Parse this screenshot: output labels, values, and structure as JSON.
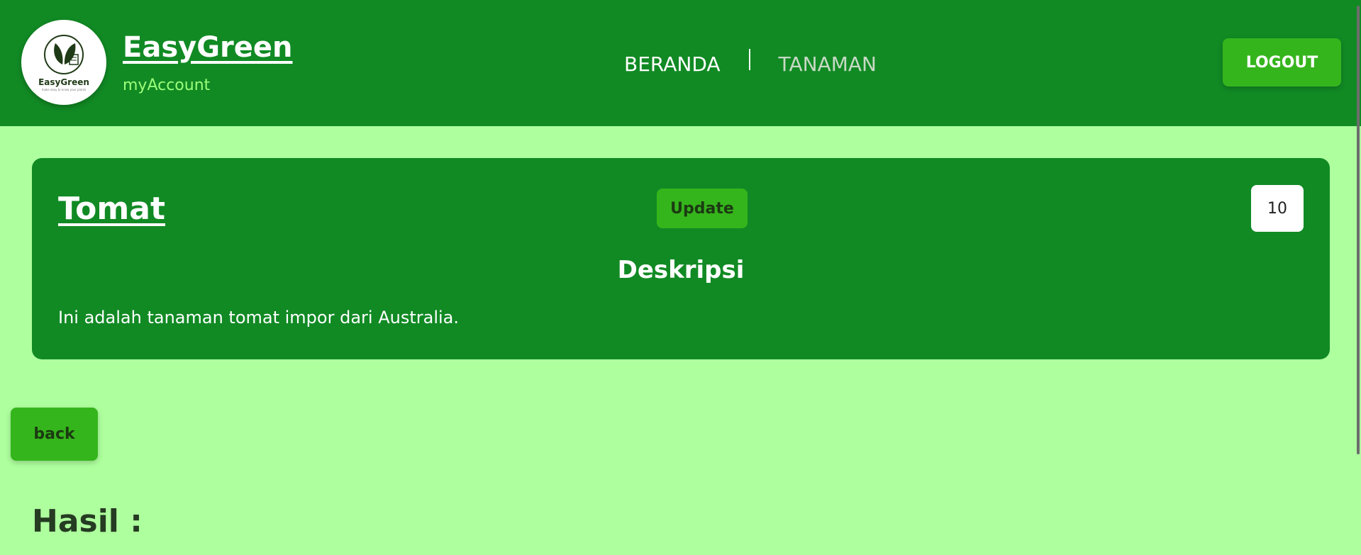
{
  "header": {
    "logo_text": "EasyGreen",
    "logo_tagline": "make easy to know your plants",
    "brand": "EasyGreen",
    "sub_brand": "myAccount",
    "nav": [
      {
        "label": "BERANDA"
      },
      {
        "label": "TANAMAN"
      }
    ],
    "logout_label": "LOGOUT"
  },
  "plant": {
    "name": "Tomat",
    "update_label": "Update",
    "quantity": "10",
    "description_heading": "Deskripsi",
    "description": "Ini adalah tanaman tomat impor dari Australia."
  },
  "back_label": "back",
  "result_heading": "Hasil :",
  "colors": {
    "header_bg": "#118a24",
    "page_bg": "#aeff9e",
    "button_bg": "#35b51c",
    "sub_brand": "#9cff7a"
  },
  "icons": {
    "logo": "leaf-logo-icon"
  }
}
